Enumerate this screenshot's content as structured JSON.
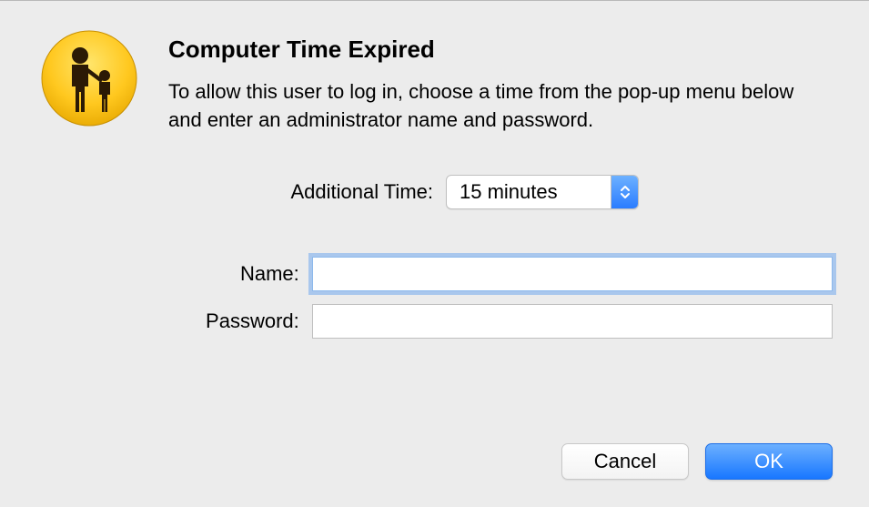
{
  "dialog": {
    "title": "Computer Time Expired",
    "description": "To allow this user to log in, choose a time from the pop-up menu below and enter an administrator name and password.",
    "additional_time_label": "Additional Time:",
    "additional_time_value": "15 minutes",
    "name_label": "Name:",
    "name_value": "",
    "password_label": "Password:",
    "password_value": "",
    "cancel_label": "Cancel",
    "ok_label": "OK"
  }
}
